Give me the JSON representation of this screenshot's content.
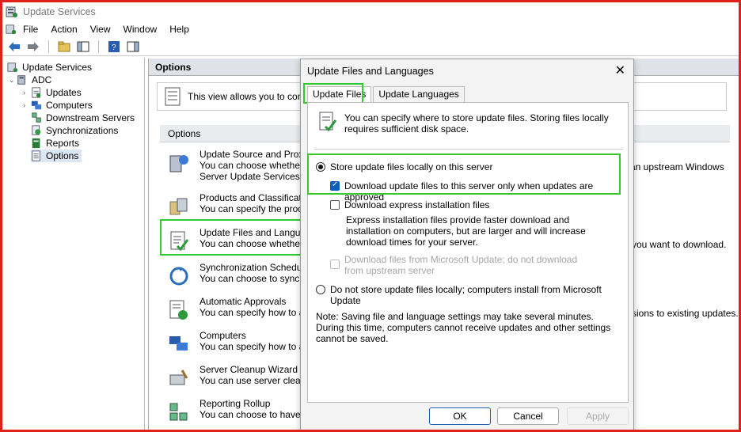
{
  "window": {
    "title": "Update Services"
  },
  "menu": [
    "File",
    "Action",
    "View",
    "Window",
    "Help"
  ],
  "tree": {
    "root": "Update Services",
    "server": "ADC",
    "children": [
      "Updates",
      "Computers",
      "Downstream Servers",
      "Synchronizations",
      "Reports",
      "Options"
    ]
  },
  "options_pane": {
    "header": "Options",
    "info_text": "This view allows you to configu",
    "section_header": "Options",
    "items": [
      {
        "title": "Update Source and Proxy S",
        "desc": "You can choose whether th",
        "desc2": "Server Update Services se"
      },
      {
        "title": "Products and Classificatio",
        "desc": "You can specify the produc",
        "desc2": ""
      },
      {
        "title": "Update Files and Language",
        "desc": "You can choose whether to",
        "desc2": ""
      },
      {
        "title": "Synchronization Schedule",
        "desc": "You can choose to synchro",
        "desc2": ""
      },
      {
        "title": "Automatic Approvals",
        "desc": "You can specify how to aut",
        "desc2": ""
      },
      {
        "title": "Computers",
        "desc": "You can specify how to ass",
        "desc2": ""
      },
      {
        "title": "Server Cleanup Wizard",
        "desc": "You can use server cleanup",
        "desc2": ""
      },
      {
        "title": "Reporting Rollup",
        "desc": "You can choose to have rep",
        "desc2": ""
      }
    ],
    "right_texts": {
      "upstream": "an upstream Windows",
      "download": "you want to download.",
      "existing": "sions to existing updates."
    }
  },
  "dialog": {
    "title": "Update Files and Languages",
    "tabs": [
      "Update Files",
      "Update Languages"
    ],
    "intro": "You can specify where to store update files. Storing files locally requires sufficient disk space.",
    "store_locally": "Store update files locally on this server",
    "download_approved": "Download update files to this server only when updates are approved",
    "express": "Download express installation files",
    "express_desc": "Express installation files provide faster download and installation on computers, but are larger and will increase download times for your server.",
    "from_microsoft": "Download files from Microsoft Update; do not download from upstream server",
    "do_not_store": "Do not store update files locally; computers install from Microsoft Update",
    "note": "Note: Saving file and language settings may take several minutes. During this time, computers cannot receive updates and other settings cannot be saved.",
    "buttons": {
      "ok": "OK",
      "cancel": "Cancel",
      "apply": "Apply"
    }
  },
  "colors": {
    "highlight": "#35c92b",
    "frame": "#e0201b",
    "checkbox": "#0b5fba"
  }
}
